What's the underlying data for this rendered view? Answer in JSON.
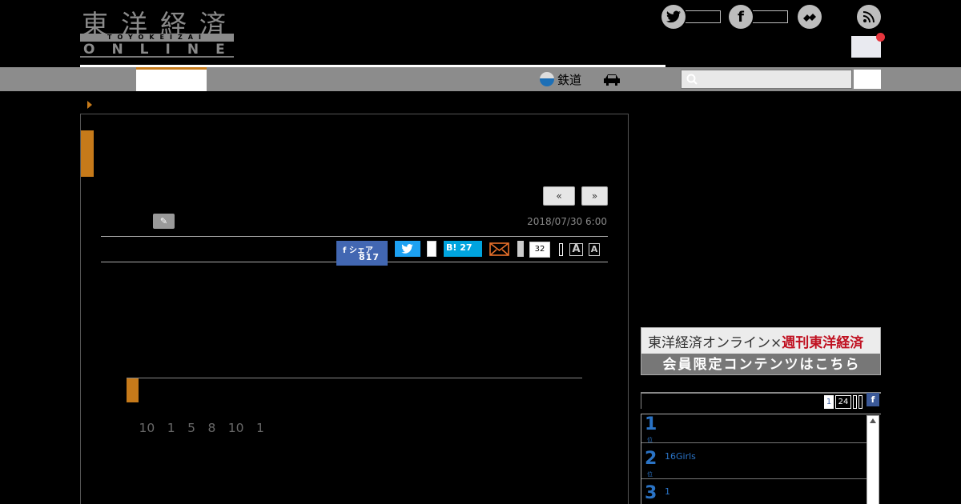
{
  "site": {
    "logo_kanji": "東洋経済",
    "logo_bar": "TOYOKEIZAI",
    "logo_online": "ONLINE"
  },
  "header": {
    "social_icons": [
      "twitter-icon",
      "facebook-icon",
      "messenger-icon",
      "rss-icon"
    ]
  },
  "nav": {
    "rail_label": "鉄道",
    "search_placeholder": ""
  },
  "article": {
    "pager_prev": "«",
    "pager_next": "»",
    "date": "2018/07/30 6:00",
    "share": {
      "facebook_label": "シェア",
      "facebook_count": "817",
      "hatena_label": "B!",
      "hatena_count": "27",
      "comment_count": "32",
      "font_large": "A",
      "font_small": "A"
    },
    "para1": "　",
    "heading": "",
    "para2": "　10　1　5　8　10　1"
  },
  "sidebar": {
    "banner_top": "東洋経済オンライン×",
    "banner_brand": "週刊東洋経済",
    "banner_bottom": "会員限定コンテンツはこちら",
    "ranking": {
      "tab_1": "1",
      "tab_24": "24",
      "fb_tab": "f",
      "items": [
        {
          "rank": "1",
          "title": ""
        },
        {
          "rank": "2",
          "title": "16Girls"
        },
        {
          "rank": "3",
          "title": "1"
        }
      ]
    }
  },
  "colors": {
    "accent": "#c67a1a",
    "facebook": "#4267b2",
    "twitter": "#1da1f2",
    "hatena": "#00a4de",
    "rank_blue": "#2a73c5"
  }
}
